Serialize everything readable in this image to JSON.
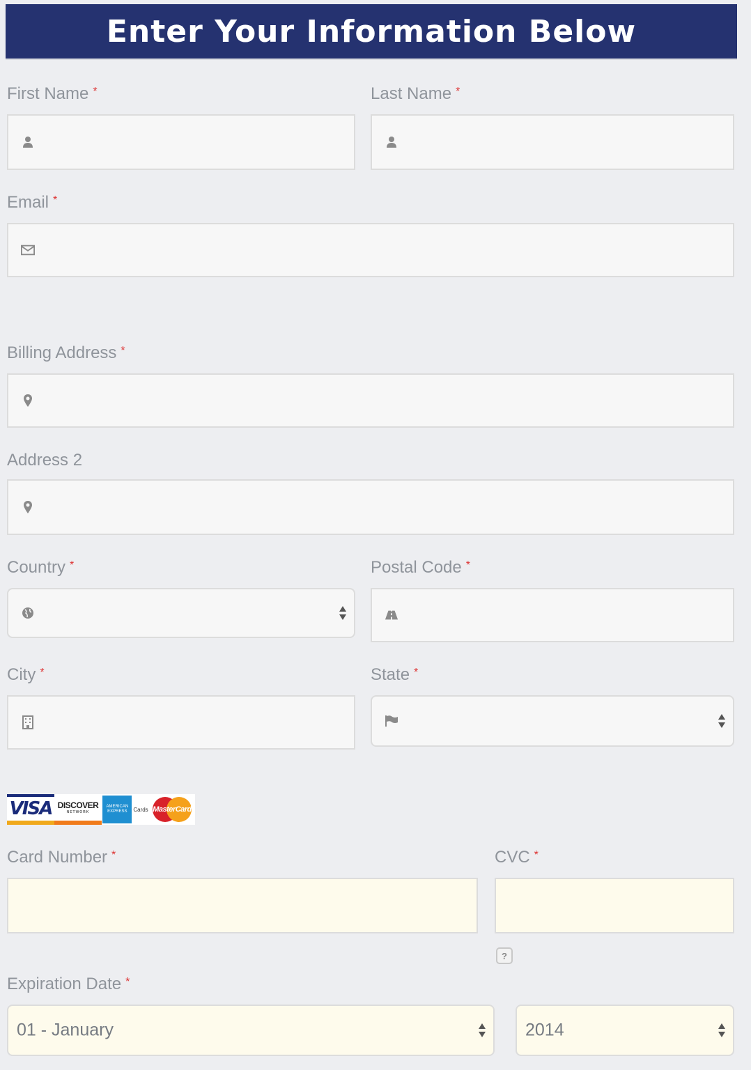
{
  "header": {
    "title": "Enter Your Information Below"
  },
  "required_marker": "*",
  "fields": {
    "first_name": {
      "label": "First Name",
      "icon": "user-icon",
      "value": ""
    },
    "last_name": {
      "label": "Last Name",
      "icon": "user-icon",
      "value": ""
    },
    "email": {
      "label": "Email",
      "icon": "envelope-icon",
      "value": ""
    },
    "billing_address": {
      "label": "Billing Address",
      "icon": "map-marker-icon",
      "value": ""
    },
    "address2": {
      "label": "Address 2",
      "icon": "map-marker-icon",
      "value": ""
    },
    "country": {
      "label": "Country",
      "icon": "globe-icon",
      "value": ""
    },
    "postal_code": {
      "label": "Postal Code",
      "icon": "road-icon",
      "value": ""
    },
    "city": {
      "label": "City",
      "icon": "building-icon",
      "value": ""
    },
    "state": {
      "label": "State",
      "icon": "flag-icon",
      "value": ""
    },
    "card_number": {
      "label": "Card Number",
      "value": ""
    },
    "cvc": {
      "label": "CVC",
      "value": "",
      "help": "?"
    },
    "expiration": {
      "label": "Expiration Date",
      "month": "01 - January",
      "year": "2014"
    }
  },
  "card_logos": {
    "visa": "VISA",
    "discover": "DISCOVER",
    "discover_sub": "NETWORK",
    "amex_line1": "AMERICAN",
    "amex_line2": "EXPRESS",
    "amex_cards": "Cards",
    "mastercard": "MasterCard"
  },
  "colors": {
    "header_bg": "#253270",
    "background": "#edeef1",
    "required": "#dd3333",
    "card_field_bg": "#fefbec"
  }
}
